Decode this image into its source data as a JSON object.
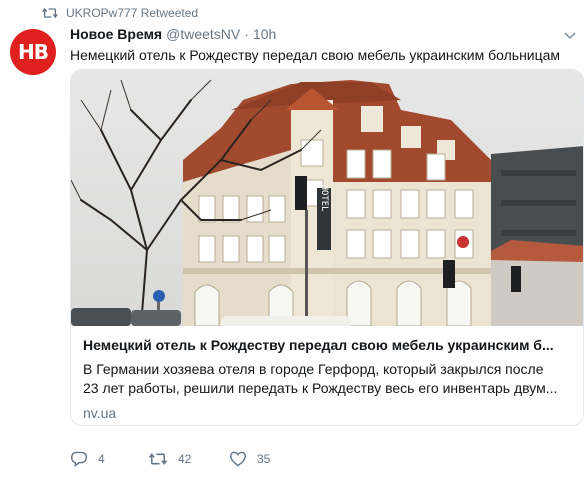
{
  "retweet": {
    "label": "UKROPw777 Retweeted"
  },
  "author": {
    "avatar_text": "НВ",
    "name": "Новое Время",
    "handle": "@tweetsNV",
    "separator": "·",
    "time": "10h"
  },
  "tweet": {
    "text": "Немецкий отель к Рождеству передал свою мебель украинским больницам"
  },
  "card": {
    "title": "Немецкий отель к Рождеству передал свою мебель украинским б...",
    "description_line1": "В Германии хозяева отеля в городе Герфорд, который закрылся после",
    "description_line2": "23 лет работы, решили передать к Рождеству весь его инвентарь двум...",
    "domain": "nv.ua",
    "building_sign": "HOTEL"
  },
  "actions": {
    "replies": "4",
    "retweets": "42",
    "likes": "35"
  },
  "colors": {
    "avatar": "#e0201f",
    "muted": "#657786",
    "border": "#e1e8ed"
  }
}
